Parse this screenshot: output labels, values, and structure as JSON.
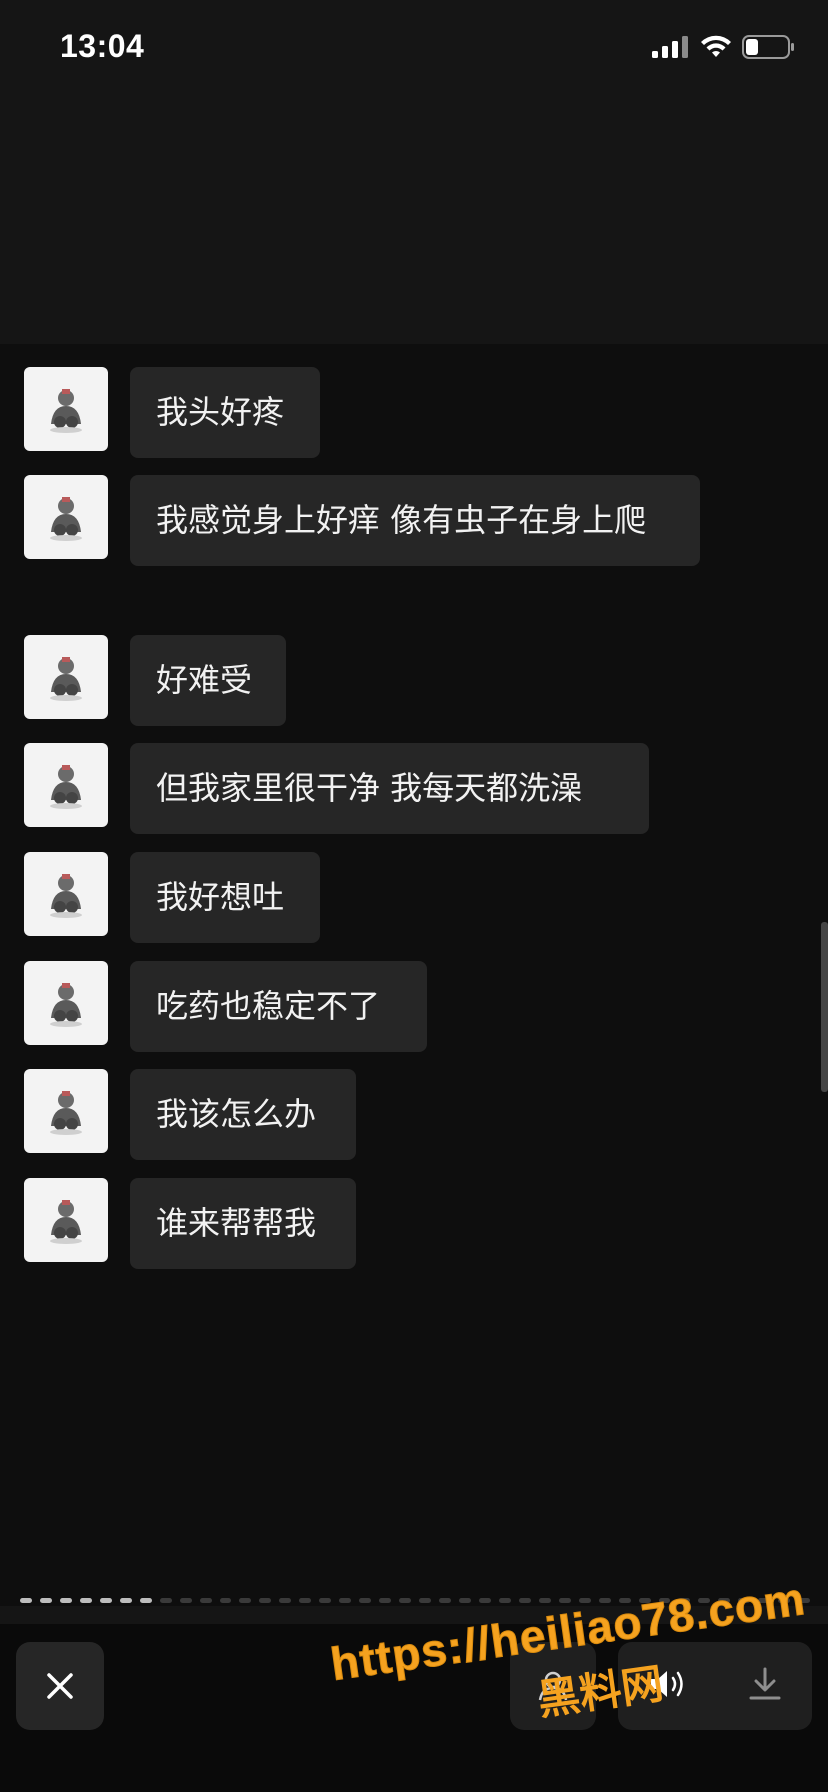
{
  "status_bar": {
    "time": "13:04"
  },
  "messages": [
    {
      "text": "我头好疼"
    },
    {
      "text": "我感觉身上好痒 像有虫子在身上爬"
    },
    {
      "text": "好难受"
    },
    {
      "text": "但我家里很干净 我每天都洗澡"
    },
    {
      "text": "我好想吐"
    },
    {
      "text": "吃药也稳定不了"
    },
    {
      "text": "我该怎么办"
    },
    {
      "text": "谁来帮帮我"
    }
  ],
  "story_progress": {
    "total_segments": 40,
    "completed_segments": 7
  },
  "toolbar": {
    "close_icon": "close-icon",
    "profile_icon": "person-icon",
    "volume_icon": "speaker-icon",
    "download_icon": "download-icon"
  },
  "watermark": {
    "url": "https://heiliao78.com",
    "name": "黑料网"
  },
  "colors": {
    "background": "#0e0e0e",
    "bubble": "#262626",
    "watermark": "#f5a21f"
  }
}
